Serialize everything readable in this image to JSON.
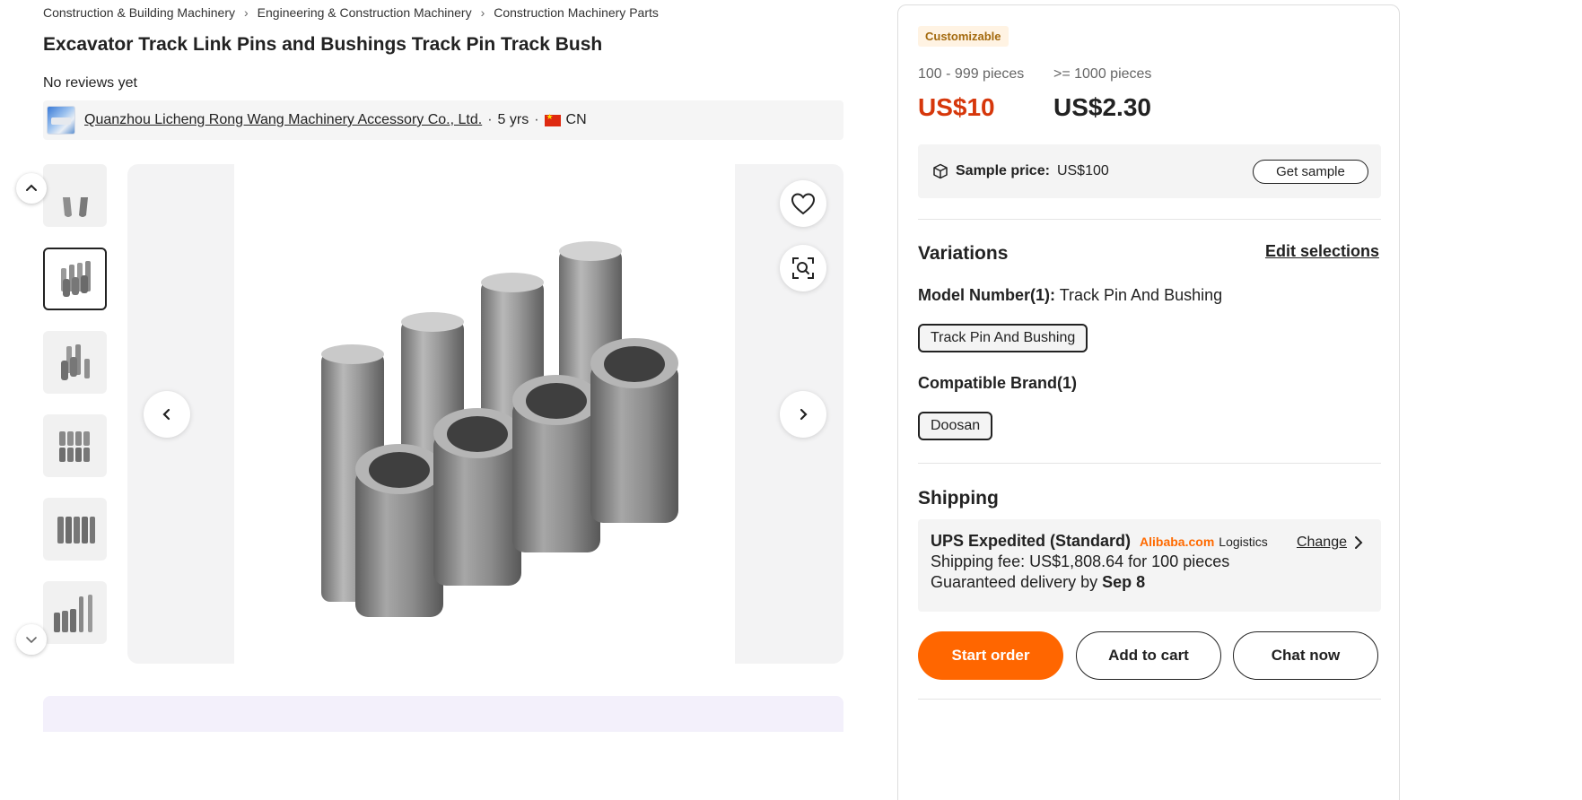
{
  "breadcrumb": [
    "Construction & Building Machinery",
    "Engineering & Construction Machinery",
    "Construction Machinery Parts"
  ],
  "product": {
    "title": "Excavator Track Link Pins and Bushings Track Pin Track Bush",
    "reviews": "No reviews yet"
  },
  "supplier": {
    "name": "Quanzhou Licheng Rong Wang Machinery Accessory Co., Ltd.",
    "years": "5 yrs",
    "country": "CN"
  },
  "gallery": {
    "thumb_count": 6,
    "active_index": 1
  },
  "pricing": {
    "badge": "Customizable",
    "tiers": [
      {
        "qty": "100 - 999 pieces",
        "price": "US$10"
      },
      {
        "qty": ">= 1000 pieces",
        "price": "US$2.30"
      }
    ],
    "accent_color": "#d6370b"
  },
  "sample": {
    "label": "Sample price:",
    "value": "US$100",
    "button": "Get sample"
  },
  "variations": {
    "heading": "Variations",
    "edit_label": "Edit selections",
    "model": {
      "key": "Model Number(1):",
      "value": "Track Pin And Bushing",
      "option": "Track Pin And Bushing"
    },
    "brand": {
      "key": "Compatible Brand(1)",
      "option": "Doosan"
    }
  },
  "shipping": {
    "heading": "Shipping",
    "method": "UPS Expedited (Standard)",
    "carrier_brand": "Alibaba.com",
    "carrier_suffix": "Logistics",
    "change_label": "Change",
    "fee_prefix": "Shipping fee: US$1,808.64 for 100 pieces",
    "delivery_prefix": "Guaranteed delivery by",
    "delivery_date": "Sep 8"
  },
  "actions": {
    "start_order": "Start order",
    "add_to_cart": "Add to cart",
    "chat_now": "Chat now",
    "primary_color": "#ff6600"
  }
}
